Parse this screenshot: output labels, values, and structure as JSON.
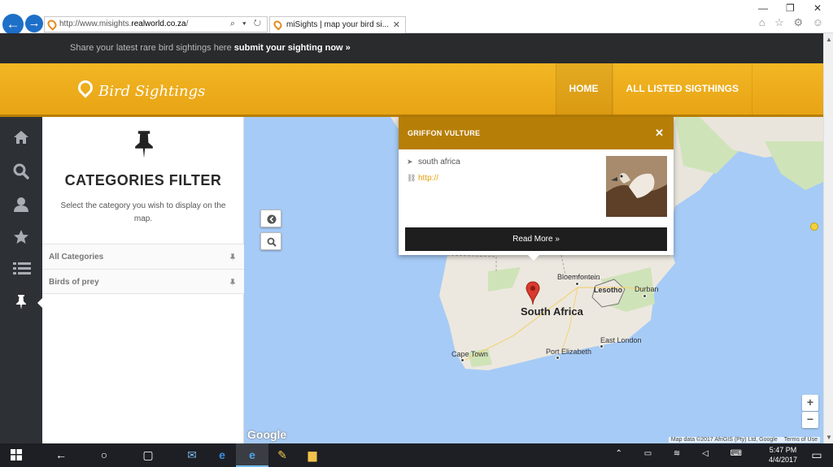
{
  "browser": {
    "url_prefix": "http://www.misights.",
    "url_domain": "realworld.co.za",
    "url_suffix": "/",
    "address_tools": "⌕ ▾ ↻",
    "tab_title": "miSights | map your bird si...",
    "tab_close": "✕",
    "back": "←",
    "forward": "→",
    "window_controls": {
      "minimize": "—",
      "restore": "❐",
      "close": "✕"
    },
    "toolbar_icons": "⌂ ☆ ⚙ ☺"
  },
  "topbar": {
    "message": "Share your latest rare bird sightings here ",
    "link": "submit your sighting now »"
  },
  "header": {
    "logo_text": "Bird Sightings",
    "menu": [
      {
        "label": "HOME"
      },
      {
        "label": "ALL LISTED SIGTHINGS"
      }
    ]
  },
  "panel": {
    "title": "CATEGORIES FILTER",
    "description": "Select the category you wish to display on the map.",
    "categories": [
      {
        "label": "All Categories"
      },
      {
        "label": "Birds of prey"
      }
    ]
  },
  "map": {
    "places": {
      "bloemfontein": "Bloemfontein",
      "lesotho": "Lesotho",
      "durban": "Durban",
      "south_africa": "South Africa",
      "east_london": "East London",
      "port_elizabeth": "Port Elizabeth",
      "cape_town": "Cape Town"
    },
    "zoom_in": "+",
    "zoom_out": "−",
    "google": "Google",
    "attribution": "Map data ©2017 AfriGIS (Pty) Ltd, Google",
    "terms": "Terms of Use"
  },
  "popup": {
    "title": "GRIFFON VULTURE",
    "close": "✕",
    "location": "south africa",
    "link": "http://",
    "read_more": "Read More »"
  },
  "taskbar": {
    "time": "5:47 PM",
    "date": "4/4/2017"
  },
  "colors": {
    "header_gold": "#f0b21e",
    "popup_header": "#b77e07",
    "topbar": "#2a2b2d",
    "rail": "#2d3035",
    "map_water": "#a6cbf6",
    "marker": "#d93a2f"
  }
}
